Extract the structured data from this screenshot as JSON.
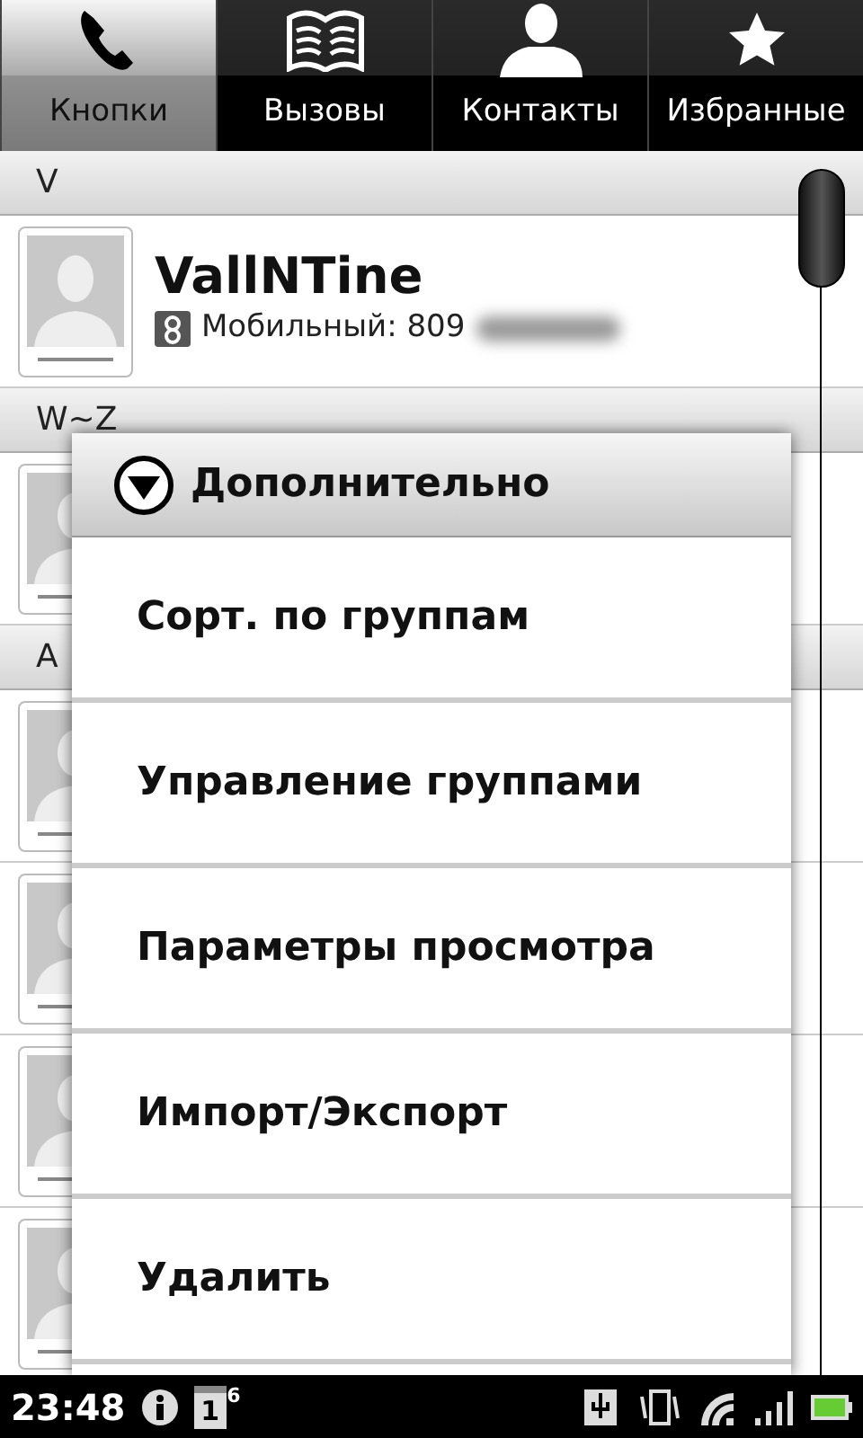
{
  "tabs": [
    {
      "label": "Кнопки",
      "kind": "phone",
      "selected": true
    },
    {
      "label": "Вызовы",
      "kind": "book",
      "selected": false
    },
    {
      "label": "Контакты",
      "kind": "person",
      "selected": false
    },
    {
      "label": "Избранные",
      "kind": "star",
      "selected": false
    }
  ],
  "sections": [
    {
      "letter": "V",
      "contacts": [
        {
          "kind": "full",
          "name": "VallNTine",
          "detail": "Мобильный: 809"
        }
      ]
    },
    {
      "letter": "W~Z",
      "contacts": [
        {
          "kind": "covered"
        }
      ]
    },
    {
      "letter": "A",
      "contacts": [
        {
          "kind": "covered"
        },
        {
          "kind": "covered"
        },
        {
          "kind": "covered"
        },
        {
          "kind": "covered"
        }
      ]
    }
  ],
  "menu": {
    "title": "Дополнительно",
    "items": [
      "Сорт. по группам",
      "Управление группами",
      "Параметры просмотра",
      "Импорт/Экспорт",
      "Удалить"
    ]
  },
  "status_bar": {
    "time": "23:48",
    "calendar_day": "1",
    "notification_count": "6"
  }
}
